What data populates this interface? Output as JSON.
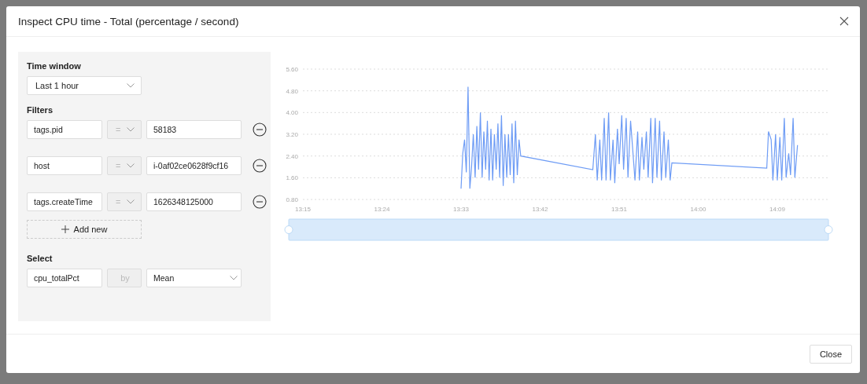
{
  "dialog": {
    "title": "Inspect CPU time - Total (percentage / second)",
    "close_label": "Close"
  },
  "time_window": {
    "label": "Time window",
    "value": "Last 1 hour"
  },
  "filters": {
    "label": "Filters",
    "add_label": "Add new",
    "rows": [
      {
        "field": "tags.pid",
        "operator": "=",
        "operator_disabled": true,
        "value": "58183"
      },
      {
        "field": "host",
        "operator": "=",
        "operator_disabled": true,
        "value": "i-0af02ce0628f9cf16"
      },
      {
        "field": "tags.createTime",
        "operator": "=",
        "operator_disabled": true,
        "value": "1626348125000"
      }
    ]
  },
  "select": {
    "label": "Select",
    "field": "cpu_totalPct",
    "by": "by",
    "by_disabled": true,
    "aggregate": "Mean"
  },
  "chart_data": {
    "type": "line",
    "grid": true,
    "xlim": [
      795,
      855
    ],
    "ylim": [
      0.8,
      5.6
    ],
    "xticks": [
      {
        "value": 795,
        "label": "13:15"
      },
      {
        "value": 804,
        "label": "13:24"
      },
      {
        "value": 813,
        "label": "13:33"
      },
      {
        "value": 822,
        "label": "13:42"
      },
      {
        "value": 831,
        "label": "13:51"
      },
      {
        "value": 840,
        "label": "14:00"
      },
      {
        "value": 849,
        "label": "14:09"
      }
    ],
    "yticks": [
      {
        "value": 0.8,
        "label": "0.80"
      },
      {
        "value": 1.6,
        "label": "1.60"
      },
      {
        "value": 2.4,
        "label": "2.40"
      },
      {
        "value": 3.2,
        "label": "3.20"
      },
      {
        "value": 4.0,
        "label": "4.00"
      },
      {
        "value": 4.8,
        "label": "4.80"
      },
      {
        "value": 5.6,
        "label": "5.60"
      }
    ],
    "x": [
      813.0,
      813.2,
      813.4,
      813.6,
      813.8,
      814.0,
      814.2,
      814.4,
      814.6,
      814.8,
      815.0,
      815.2,
      815.4,
      815.6,
      815.8,
      816.0,
      816.2,
      816.4,
      816.6,
      816.8,
      817.0,
      817.2,
      817.4,
      817.6,
      817.8,
      818.0,
      818.2,
      818.4,
      818.6,
      818.8,
      819.0,
      819.2,
      819.4,
      819.6,
      819.8,
      828.0,
      828.3,
      828.5,
      828.8,
      829.0,
      829.3,
      829.5,
      829.8,
      830.0,
      830.3,
      830.5,
      830.8,
      831.0,
      831.3,
      831.5,
      831.8,
      832.0,
      832.3,
      832.5,
      832.8,
      833.1,
      833.3,
      833.6,
      833.8,
      834.1,
      834.3,
      834.6,
      834.8,
      835.1,
      835.3,
      835.6,
      835.8,
      836.1,
      836.3,
      836.6,
      836.8,
      837.0,
      847.8,
      848.0,
      848.3,
      848.5,
      848.8,
      849.0,
      849.3,
      849.5,
      849.8,
      850.0,
      850.3,
      850.5,
      850.8,
      851.0,
      851.3
    ],
    "series": [
      {
        "color": "#6e9cf5",
        "values": [
          1.2,
          2.5,
          3.0,
          1.8,
          4.95,
          1.2,
          2.0,
          3.2,
          1.6,
          3.5,
          1.9,
          4.0,
          1.6,
          3.3,
          1.9,
          3.7,
          1.5,
          3.4,
          1.5,
          3.2,
          1.9,
          3.6,
          1.6,
          3.9,
          1.3,
          3.2,
          1.6,
          3.2,
          1.7,
          3.6,
          1.4,
          3.7,
          1.7,
          3.0,
          2.4,
          1.9,
          3.2,
          1.5,
          3.0,
          1.5,
          3.8,
          1.5,
          4.0,
          1.5,
          3.0,
          1.4,
          3.4,
          2.1,
          3.9,
          1.9,
          3.8,
          1.6,
          3.7,
          2.8,
          1.5,
          3.3,
          1.5,
          3.1,
          1.9,
          3.3,
          1.6,
          3.8,
          1.4,
          3.8,
          1.6,
          3.7,
          1.5,
          3.3,
          1.6,
          3.0,
          1.5,
          2.15,
          1.95,
          3.3,
          3.0,
          1.5,
          3.2,
          1.5,
          3.1,
          1.5,
          3.8,
          1.6,
          2.5,
          1.7,
          3.8,
          1.6,
          2.8
        ]
      }
    ]
  }
}
